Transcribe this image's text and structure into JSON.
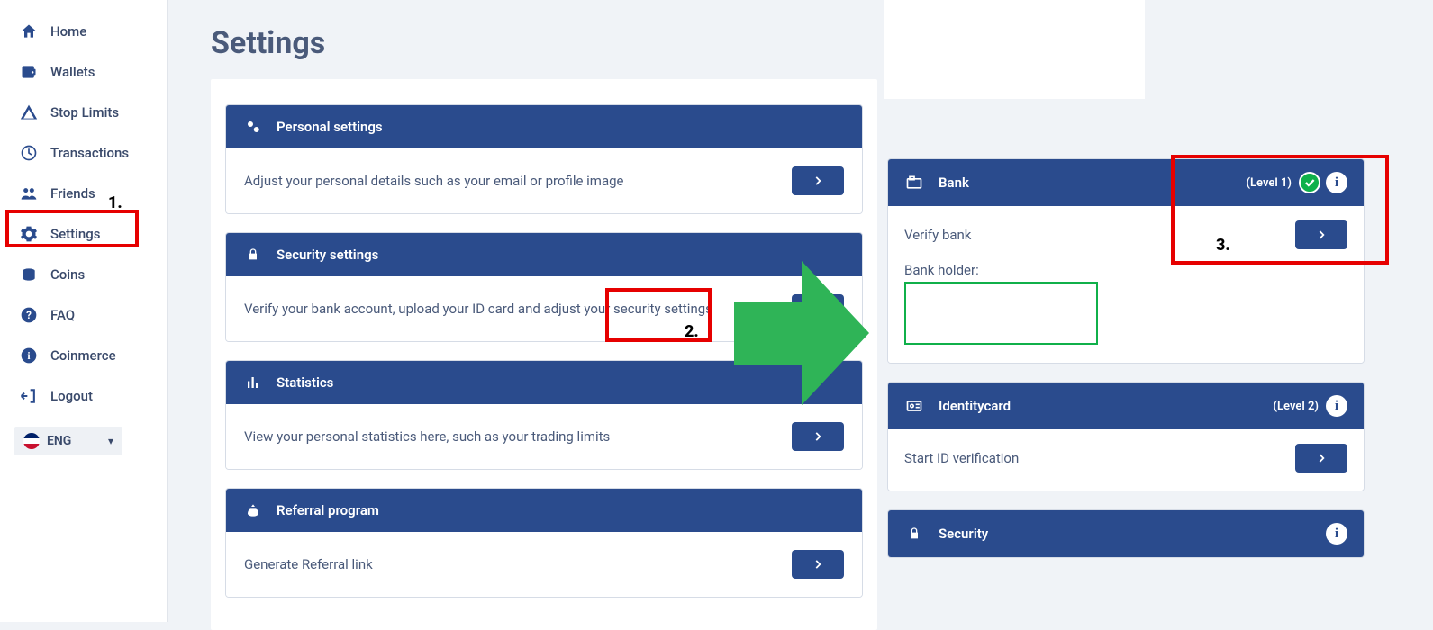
{
  "sidebar": {
    "items": [
      {
        "label": "Home"
      },
      {
        "label": "Wallets"
      },
      {
        "label": "Stop Limits"
      },
      {
        "label": "Transactions"
      },
      {
        "label": "Friends"
      },
      {
        "label": "Settings"
      },
      {
        "label": "Coins"
      },
      {
        "label": "FAQ"
      },
      {
        "label": "Coinmerce"
      },
      {
        "label": "Logout"
      }
    ],
    "lang": "ENG"
  },
  "page": {
    "title": "Settings"
  },
  "cards": {
    "personal": {
      "title": "Personal settings",
      "desc": "Adjust your personal details such as your email or profile image"
    },
    "security": {
      "title": "Security settings",
      "desc": "Verify your bank account, upload your ID card and adjust your security settings"
    },
    "statistics": {
      "title": "Statistics",
      "desc": "View your personal statistics here, such as your trading limits"
    },
    "referral": {
      "title": "Referral program",
      "desc": "Generate Referral link"
    }
  },
  "right": {
    "bank": {
      "title": "Bank",
      "level": "(Level 1)",
      "verify": "Verify bank",
      "holder": "Bank holder:"
    },
    "identity": {
      "title": "Identitycard",
      "level": "(Level 2)",
      "desc": "Start ID verification"
    },
    "security": {
      "title": "Security"
    }
  },
  "annotations": {
    "a1": "1.",
    "a2": "2.",
    "a3": "3."
  }
}
